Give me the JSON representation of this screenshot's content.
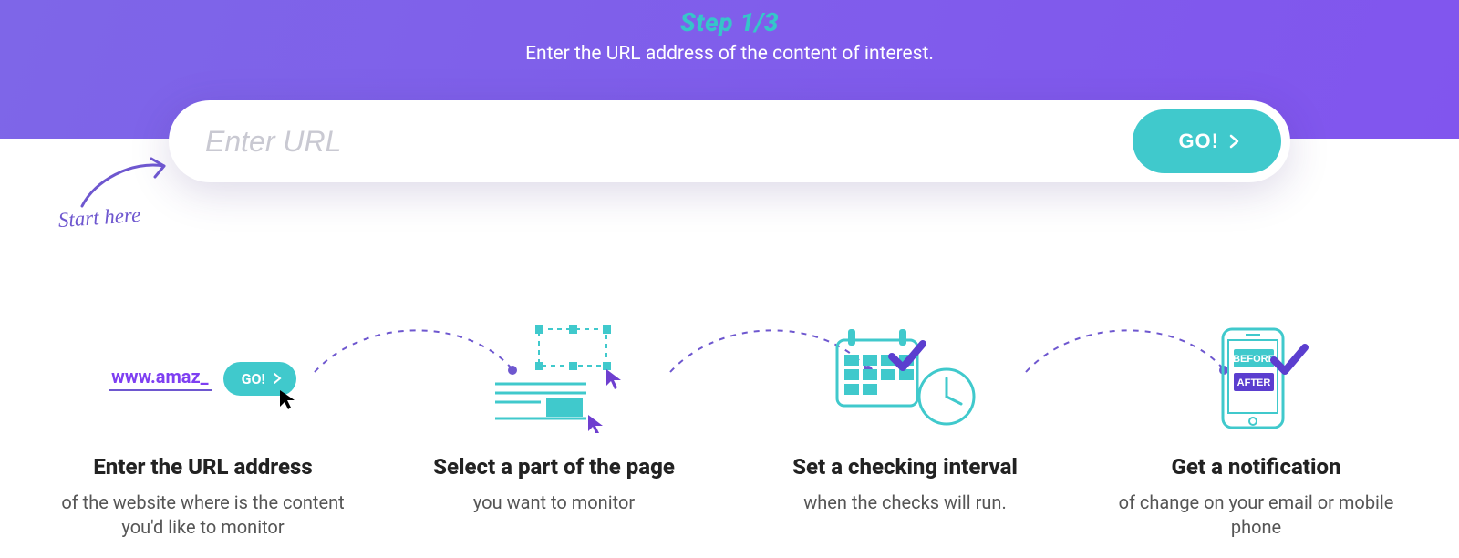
{
  "header": {
    "step_label": "Step 1/3",
    "step_desc": "Enter the URL address of the content of interest."
  },
  "url_bar": {
    "placeholder": "Enter URL",
    "go_label": "GO!"
  },
  "start_here": "Start here",
  "colors": {
    "accent_teal": "#40c9cc",
    "accent_purple": "#7e66e8",
    "brand_violet": "#6e57cf"
  },
  "steps": [
    {
      "illus_text": "www.amaz_",
      "illus_btn": "GO!",
      "title": "Enter the URL address",
      "sub": "of the website where is the content you'd like to monitor"
    },
    {
      "title": "Select a part of the page",
      "sub": "you want to monitor"
    },
    {
      "title": "Set a checking interval",
      "sub": "when the checks will run."
    },
    {
      "badge_before": "BEFORE",
      "badge_after": "AFTER",
      "title": "Get a notification",
      "sub": "of change on your email or mobile phone"
    }
  ]
}
